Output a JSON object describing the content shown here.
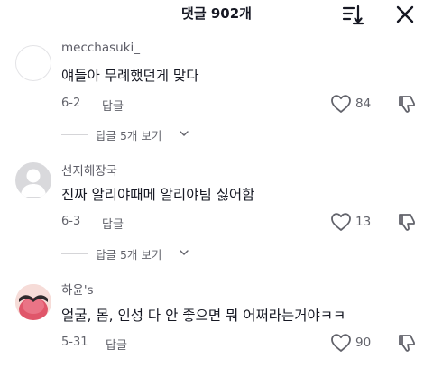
{
  "header": {
    "title": "댓글 902개",
    "sort_icon": "sort-descending-icon",
    "close_icon": "close-icon"
  },
  "comments": [
    {
      "username": "mecchasuki_",
      "text": "얘들아 무례했던게 맞다",
      "date": "6-2",
      "reply_label": "답글",
      "likes": "84",
      "replies_label": "답글 5개 보기",
      "avatar": "empty-avatar"
    },
    {
      "username": "선지해장국",
      "text": "진짜 알리야때메 알리야팀 싫어함",
      "date": "6-3",
      "reply_label": "답글",
      "likes": "13",
      "replies_label": "답글 5개 보기",
      "avatar": "default-user-avatar"
    },
    {
      "username": "하윤's",
      "text": "얼굴, 몸, 인성 다 안 좋으면 뭐 어쩌라는거야ㅋㅋ",
      "date": "5-31",
      "reply_label": "답글",
      "likes": "90",
      "avatar": "photo-avatar"
    }
  ],
  "colors": {
    "text": "#161823",
    "secondary": "#62636b",
    "divider": "#d5d5d8"
  }
}
